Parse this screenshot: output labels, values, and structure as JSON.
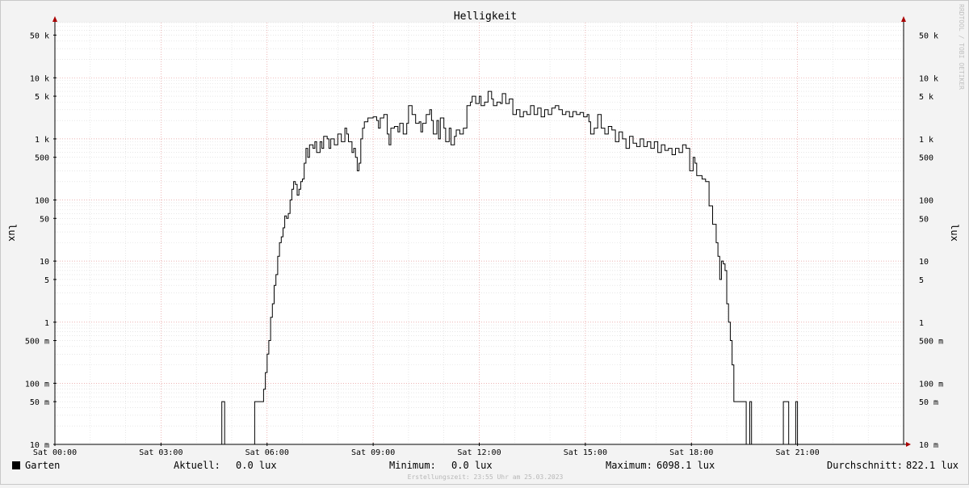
{
  "chart_data": {
    "type": "line",
    "title": "Helligkeit",
    "ylabel": "lux",
    "yscale": "log",
    "ylim": [
      0.01,
      80000
    ],
    "xlim": [
      0,
      24
    ],
    "x_tick_labels": [
      "Sat 00:00",
      "Sat 03:00",
      "Sat 06:00",
      "Sat 09:00",
      "Sat 12:00",
      "Sat 15:00",
      "Sat 18:00",
      "Sat 21:00"
    ],
    "x_tick_hours": [
      0,
      3,
      6,
      9,
      12,
      15,
      18,
      21
    ],
    "y_ticks": [
      {
        "value": 50000,
        "label": "50 k"
      },
      {
        "value": 10000,
        "label": "10 k"
      },
      {
        "value": 5000,
        "label": "5 k"
      },
      {
        "value": 1000,
        "label": "1 k"
      },
      {
        "value": 500,
        "label": "500"
      },
      {
        "value": 100,
        "label": "100"
      },
      {
        "value": 50,
        "label": "50"
      },
      {
        "value": 10,
        "label": "10"
      },
      {
        "value": 5,
        "label": "5"
      },
      {
        "value": 1,
        "label": "1"
      },
      {
        "value": 0.5,
        "label": "500 m"
      },
      {
        "value": 0.1,
        "label": "100 m"
      },
      {
        "value": 0.05,
        "label": "50 m"
      },
      {
        "value": 0.01,
        "label": "10 m"
      }
    ],
    "grid": true,
    "series": [
      {
        "name": "Garten",
        "color": "#000000",
        "points": [
          [
            0.0,
            0
          ],
          [
            4.7,
            0
          ],
          [
            4.72,
            0.05
          ],
          [
            4.78,
            0.05
          ],
          [
            4.8,
            0
          ],
          [
            5.6,
            0
          ],
          [
            5.65,
            0.05
          ],
          [
            5.85,
            0.05
          ],
          [
            5.9,
            0.08
          ],
          [
            5.95,
            0.15
          ],
          [
            6.0,
            0.3
          ],
          [
            6.05,
            0.5
          ],
          [
            6.1,
            1.2
          ],
          [
            6.15,
            2.0
          ],
          [
            6.2,
            4.0
          ],
          [
            6.25,
            6
          ],
          [
            6.3,
            12
          ],
          [
            6.35,
            20
          ],
          [
            6.4,
            25
          ],
          [
            6.45,
            35
          ],
          [
            6.5,
            55
          ],
          [
            6.55,
            50
          ],
          [
            6.6,
            60
          ],
          [
            6.65,
            100
          ],
          [
            6.7,
            150
          ],
          [
            6.75,
            200
          ],
          [
            6.8,
            180
          ],
          [
            6.85,
            120
          ],
          [
            6.9,
            150
          ],
          [
            6.95,
            200
          ],
          [
            7.0,
            220
          ],
          [
            7.05,
            400
          ],
          [
            7.1,
            700
          ],
          [
            7.15,
            500
          ],
          [
            7.2,
            800
          ],
          [
            7.3,
            700
          ],
          [
            7.35,
            900
          ],
          [
            7.4,
            600
          ],
          [
            7.5,
            900
          ],
          [
            7.55,
            700
          ],
          [
            7.6,
            1100
          ],
          [
            7.7,
            1000
          ],
          [
            7.75,
            700
          ],
          [
            7.8,
            1000
          ],
          [
            7.9,
            800
          ],
          [
            8.0,
            1200
          ],
          [
            8.1,
            900
          ],
          [
            8.2,
            1500
          ],
          [
            8.25,
            1200
          ],
          [
            8.3,
            900
          ],
          [
            8.4,
            600
          ],
          [
            8.45,
            700
          ],
          [
            8.5,
            500
          ],
          [
            8.55,
            300
          ],
          [
            8.6,
            400
          ],
          [
            8.65,
            1000
          ],
          [
            8.7,
            1500
          ],
          [
            8.75,
            1900
          ],
          [
            8.85,
            2200
          ],
          [
            9.0,
            2300
          ],
          [
            9.1,
            2000
          ],
          [
            9.15,
            1500
          ],
          [
            9.2,
            2200
          ],
          [
            9.3,
            2500
          ],
          [
            9.4,
            1200
          ],
          [
            9.45,
            800
          ],
          [
            9.5,
            1500
          ],
          [
            9.6,
            1600
          ],
          [
            9.7,
            1300
          ],
          [
            9.75,
            1800
          ],
          [
            9.85,
            1200
          ],
          [
            9.95,
            1800
          ],
          [
            10.0,
            3500
          ],
          [
            10.1,
            2500
          ],
          [
            10.2,
            1800
          ],
          [
            10.3,
            1900
          ],
          [
            10.35,
            1300
          ],
          [
            10.4,
            1800
          ],
          [
            10.5,
            2500
          ],
          [
            10.6,
            3000
          ],
          [
            10.65,
            2000
          ],
          [
            10.7,
            1200
          ],
          [
            10.8,
            2000
          ],
          [
            10.85,
            1000
          ],
          [
            10.9,
            2200
          ],
          [
            11.0,
            1500
          ],
          [
            11.05,
            900
          ],
          [
            11.15,
            1500
          ],
          [
            11.2,
            800
          ],
          [
            11.3,
            1100
          ],
          [
            11.35,
            1400
          ],
          [
            11.45,
            1200
          ],
          [
            11.55,
            1500
          ],
          [
            11.65,
            3500
          ],
          [
            11.75,
            4000
          ],
          [
            11.8,
            5000
          ],
          [
            11.9,
            3800
          ],
          [
            12.0,
            5000
          ],
          [
            12.05,
            3500
          ],
          [
            12.15,
            4000
          ],
          [
            12.25,
            6000
          ],
          [
            12.35,
            4500
          ],
          [
            12.4,
            3500
          ],
          [
            12.5,
            4000
          ],
          [
            12.6,
            3800
          ],
          [
            12.65,
            5500
          ],
          [
            12.75,
            3800
          ],
          [
            12.85,
            4500
          ],
          [
            12.95,
            2500
          ],
          [
            13.05,
            3000
          ],
          [
            13.15,
            2300
          ],
          [
            13.25,
            2800
          ],
          [
            13.35,
            2500
          ],
          [
            13.45,
            3500
          ],
          [
            13.55,
            2500
          ],
          [
            13.65,
            3200
          ],
          [
            13.75,
            2300
          ],
          [
            13.85,
            3000
          ],
          [
            13.95,
            2500
          ],
          [
            14.05,
            3200
          ],
          [
            14.15,
            3500
          ],
          [
            14.25,
            3000
          ],
          [
            14.35,
            2500
          ],
          [
            14.45,
            2800
          ],
          [
            14.55,
            2300
          ],
          [
            14.65,
            2800
          ],
          [
            14.75,
            2500
          ],
          [
            14.85,
            2700
          ],
          [
            14.95,
            2300
          ],
          [
            15.05,
            2500
          ],
          [
            15.1,
            1900
          ],
          [
            15.15,
            1200
          ],
          [
            15.25,
            1500
          ],
          [
            15.35,
            2500
          ],
          [
            15.45,
            1500
          ],
          [
            15.55,
            1200
          ],
          [
            15.65,
            1600
          ],
          [
            15.75,
            1400
          ],
          [
            15.85,
            900
          ],
          [
            15.95,
            1300
          ],
          [
            16.05,
            1000
          ],
          [
            16.15,
            700
          ],
          [
            16.25,
            1100
          ],
          [
            16.35,
            850
          ],
          [
            16.45,
            750
          ],
          [
            16.55,
            1000
          ],
          [
            16.65,
            750
          ],
          [
            16.75,
            900
          ],
          [
            16.85,
            700
          ],
          [
            16.95,
            900
          ],
          [
            17.05,
            600
          ],
          [
            17.15,
            800
          ],
          [
            17.25,
            650
          ],
          [
            17.35,
            700
          ],
          [
            17.45,
            550
          ],
          [
            17.55,
            700
          ],
          [
            17.65,
            600
          ],
          [
            17.75,
            800
          ],
          [
            17.85,
            700
          ],
          [
            17.95,
            300
          ],
          [
            18.05,
            500
          ],
          [
            18.1,
            400
          ],
          [
            18.15,
            250
          ],
          [
            18.3,
            220
          ],
          [
            18.4,
            200
          ],
          [
            18.5,
            80
          ],
          [
            18.6,
            40
          ],
          [
            18.7,
            20
          ],
          [
            18.75,
            12
          ],
          [
            18.8,
            5
          ],
          [
            18.85,
            10
          ],
          [
            18.9,
            9
          ],
          [
            18.95,
            7
          ],
          [
            19.0,
            2.0
          ],
          [
            19.05,
            1.0
          ],
          [
            19.1,
            0.5
          ],
          [
            19.15,
            0.2
          ],
          [
            19.2,
            0.05
          ],
          [
            19.25,
            0.05
          ],
          [
            19.5,
            0.05
          ],
          [
            19.55,
            0
          ],
          [
            19.65,
            0.05
          ],
          [
            19.7,
            0
          ],
          [
            20.55,
            0
          ],
          [
            20.6,
            0.05
          ],
          [
            20.7,
            0.05
          ],
          [
            20.75,
            0
          ],
          [
            20.95,
            0.05
          ],
          [
            21.0,
            0
          ],
          [
            24.0,
            0
          ]
        ]
      }
    ]
  },
  "legend": {
    "series_name": "Garten",
    "current_label": "Aktuell:",
    "current_value": "0.0 lux",
    "min_label": "Minimum:",
    "min_value": "0.0 lux",
    "max_label": "Maximum:",
    "max_value": "6098.1 lux",
    "avg_label": "Durchschnitt:",
    "avg_value": "822.1 lux"
  },
  "footer": {
    "credit": "Erstellungszeit: 23:55 Uhr am 25.03.2023",
    "watermark": "RRDTOOL / TOBI OETIKER"
  }
}
